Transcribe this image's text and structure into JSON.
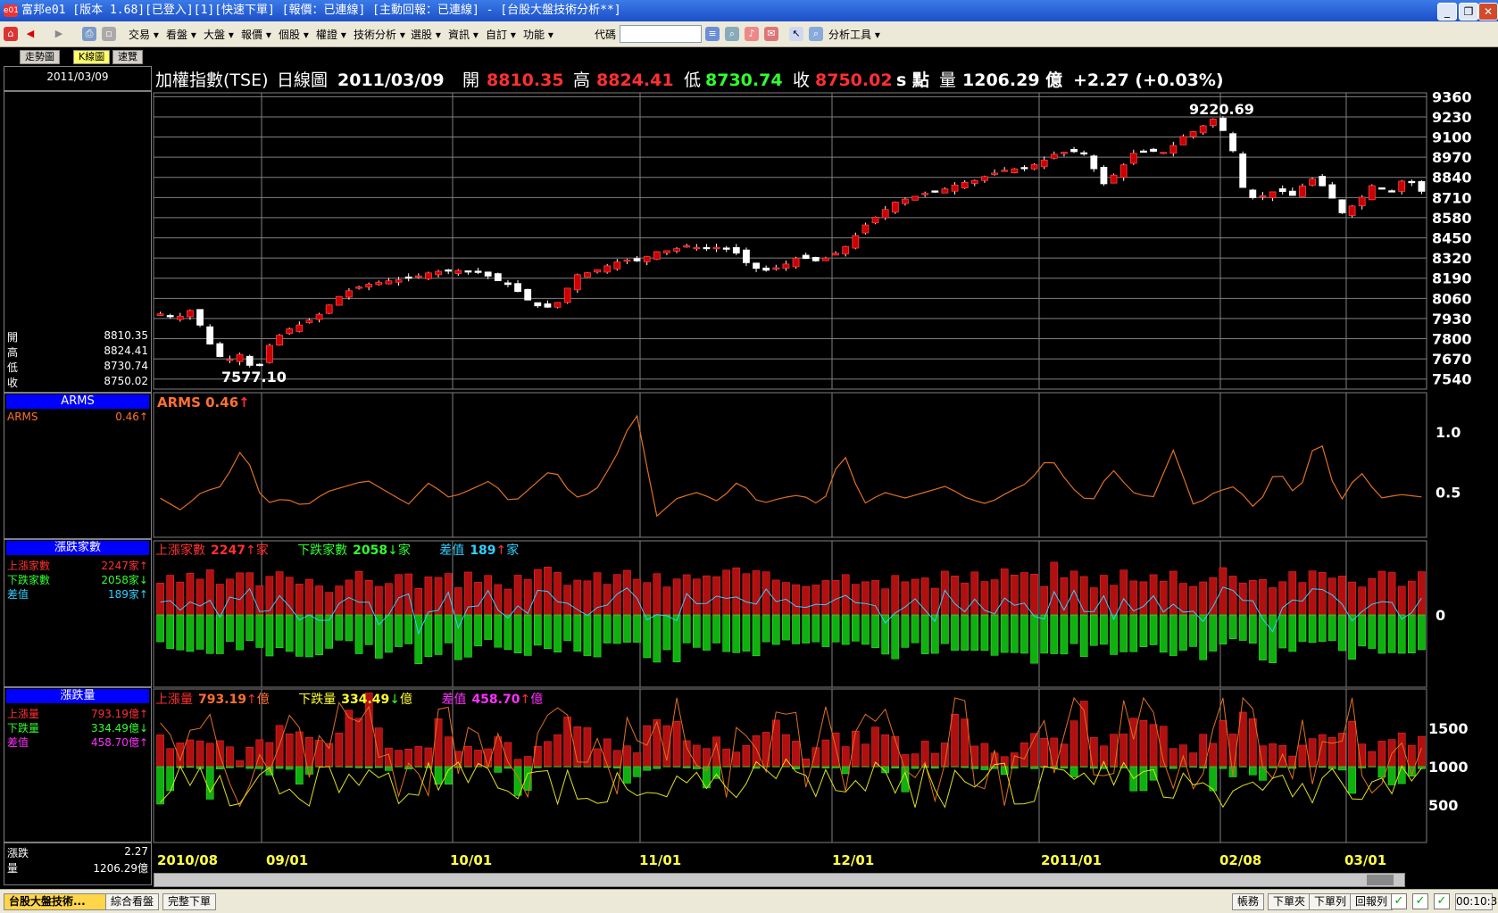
{
  "window": {
    "title": "富邦e01 [版本 1.68][已登入][1][快速下單] [報價：已連線] [主動回報：已連線] - [台股大盤技術分析**]",
    "app_icon": "e01"
  },
  "menu": {
    "items": [
      "交易",
      "看盤",
      "大盤",
      "報價",
      "個股",
      "權證",
      "技術分析",
      "選股",
      "資訊",
      "自訂",
      "功能"
    ],
    "code_label": "代碼",
    "analysis_tools": "分析工具"
  },
  "tabs": [
    "走勢圖",
    "K線圖",
    "速覽"
  ],
  "sidebar": {
    "date": "2011/03/09",
    "ohlc": [
      {
        "label": "開",
        "value": "8810.35"
      },
      {
        "label": "高",
        "value": "8824.41"
      },
      {
        "label": "低",
        "value": "8730.74"
      },
      {
        "label": "收",
        "value": "8750.02"
      }
    ],
    "arms_header": "ARMS",
    "arms": {
      "label": "ARMS",
      "value": "0.46↑"
    },
    "breadth_header": "漲跌家數",
    "breadth": [
      {
        "label": "上漲家數",
        "value": "2247家↑",
        "color": "#ff3030"
      },
      {
        "label": "下跌家數",
        "value": "2058家↓",
        "color": "#30ff30"
      },
      {
        "label": "差值",
        "value": "189家↑",
        "color": "#30d0ff"
      }
    ],
    "volume_header": "漲跌量",
    "volume": [
      {
        "label": "上漲量",
        "value": "793.19億↑",
        "color": "#ff3030"
      },
      {
        "label": "下跌量",
        "value": "334.49億↓",
        "color": "#30ff30"
      },
      {
        "label": "差值",
        "value": "458.70億↑",
        "color": "#ff30ff"
      }
    ],
    "bottom": [
      {
        "label": "漲跌",
        "value": "2.27"
      },
      {
        "label": "量",
        "value": "1206.29億"
      }
    ]
  },
  "header": {
    "title": "加權指數(TSE)",
    "chart_kind": "日線圖",
    "date": "2011/03/09",
    "open_label": "開",
    "open": "8810.35",
    "high_label": "高",
    "high": "8824.41",
    "low_label": "低",
    "low": "8730.74",
    "close_label": "收",
    "close": "8750.02",
    "unit": "s 點",
    "vol_label": "量",
    "vol": "1206.29 億",
    "change": "+2.27 (+0.03%)"
  },
  "arms_title": {
    "name": "ARMS",
    "value": "0.46"
  },
  "breadth_title": {
    "up_label": "上漲家數",
    "up": "2247",
    "down_label": "下跌家數",
    "down": "2058",
    "diff_label": "差值",
    "diff": "189",
    "unit": "家"
  },
  "volume_title": {
    "up_label": "上漲量",
    "up": "793.19",
    "down_label": "下跌量",
    "down": "334.49",
    "diff_label": "差值",
    "diff": "458.70",
    "unit": "億"
  },
  "colors": {
    "up_candle": "#cc0000",
    "down_candle": "#ffffff",
    "arms": "#e07020",
    "grid": "#808080",
    "price_label": "#ffffff",
    "up_text": "#ff3030",
    "down_text": "#30ff30"
  },
  "chart_data": {
    "type": "candlestick",
    "price_axis": {
      "ticks": [
        9360,
        9230,
        9100,
        8970,
        8840,
        8710,
        8580,
        8450,
        8320,
        8190,
        8060,
        7930,
        7800,
        7670,
        7540
      ],
      "ylim": [
        7475,
        9385
      ]
    },
    "x_ticks": [
      "2010/08",
      "09/01",
      "10/01",
      "11/01",
      "12/01",
      "2011/01",
      "02/08",
      "03/01"
    ],
    "annotations": [
      {
        "text": "9220.69",
        "kind": "high"
      },
      {
        "text": "7577.10",
        "kind": "low"
      }
    ],
    "arms_axis": {
      "ticks": [
        1.0,
        0.5
      ]
    },
    "breadth_axis": {
      "ticks": [
        0
      ]
    },
    "volume_axis": {
      "ticks": [
        1500,
        1000,
        500
      ]
    },
    "close_anchors": [
      7960,
      7930,
      7990,
      7780,
      7650,
      7700,
      7580,
      7790,
      7860,
      7900,
      7960,
      8060,
      8120,
      8150,
      8170,
      8180,
      8200,
      8230,
      8240,
      8240,
      8230,
      8180,
      8140,
      8050,
      7990,
      8040,
      8210,
      8230,
      8270,
      8310,
      8300,
      8360,
      8370,
      8400,
      8380,
      8390,
      8360,
      8260,
      8240,
      8270,
      8330,
      8300,
      8330,
      8400,
      8520,
      8600,
      8680,
      8710,
      8740,
      8760,
      8800,
      8820,
      8860,
      8890,
      8900,
      8930,
      8990,
      9010,
      8990,
      8790,
      8880,
      9000,
      9010,
      9000,
      9100,
      9150,
      9220,
      9080,
      8700,
      8720,
      8760,
      8720,
      8840,
      8770,
      8610,
      8680,
      8800,
      8740,
      8840,
      8750
    ],
    "arms_anchors": [
      0.45,
      0.35,
      0.5,
      0.55,
      0.88,
      0.4,
      0.45,
      0.38,
      0.5,
      0.55,
      0.6,
      0.5,
      0.4,
      0.58,
      0.45,
      0.52,
      0.6,
      0.4,
      0.55,
      0.7,
      0.45,
      0.5,
      0.78,
      1.18,
      0.3,
      0.45,
      0.5,
      0.42,
      0.6,
      0.4,
      0.45,
      0.48,
      0.38,
      0.85,
      0.4,
      0.5,
      0.45,
      0.5,
      0.55,
      0.45,
      0.4,
      0.5,
      0.58,
      0.8,
      0.55,
      0.4,
      0.7,
      0.5,
      0.45,
      0.85,
      0.38,
      0.5,
      0.55,
      0.35,
      0.7,
      0.45,
      1.0,
      0.4,
      0.68,
      0.45,
      0.48,
      0.46
    ],
    "breadth_up_anchors": [
      600,
      520,
      680,
      540,
      630,
      550,
      720,
      610,
      500,
      640,
      560,
      690,
      580,
      620,
      540,
      700,
      600,
      540,
      720,
      660,
      580,
      640,
      700,
      620,
      520,
      700,
      660,
      720,
      600,
      640,
      560,
      700,
      650,
      750,
      580,
      630,
      520,
      640,
      700,
      600,
      760,
      560,
      800,
      640,
      600,
      700,
      540,
      760,
      650,
      600,
      800,
      660,
      560,
      720,
      620,
      700,
      580,
      680,
      640,
      720
    ],
    "breadth_down_anchors": [
      540,
      700,
      580,
      640,
      500,
      680,
      560,
      720,
      600,
      520,
      640,
      580,
      700,
      560,
      640,
      520,
      600,
      680,
      560,
      500,
      640,
      600,
      520,
      660,
      700,
      520,
      560,
      600,
      640,
      520,
      620,
      560,
      640,
      500,
      680,
      560,
      720,
      600,
      520,
      640,
      560,
      700,
      520,
      600,
      660,
      560,
      720,
      560,
      600,
      680,
      520,
      560,
      700,
      540,
      640,
      560,
      680,
      600,
      620,
      500
    ],
    "vol_up_anchors": [
      1350,
      1200,
      1450,
      1100,
      1300,
      1550,
      1250,
      1400,
      1700,
      1150,
      1300,
      1500,
      1200,
      1350,
      1100,
      1250,
      1600,
      1300,
      1150,
      1400,
      1700,
      1200,
      1350,
      1250,
      1500,
      1100,
      1300,
      1400,
      1600,
      1200,
      1250,
      1500,
      1350,
      1100,
      1400,
      1200,
      1700,
      1300,
      1500,
      1350,
      1250,
      1400,
      1600,
      1300,
      1150,
      1450,
      1500,
      1250,
      1350,
      1400
    ],
    "vol_down_anchors": [
      700,
      50,
      650,
      30,
      40,
      520,
      40,
      30,
      300,
      40,
      50,
      400,
      30,
      40,
      600,
      30,
      60,
      40,
      350,
      40,
      30,
      500,
      40,
      30,
      50,
      40,
      300,
      30,
      40,
      500,
      30,
      40,
      600,
      30,
      40,
      350,
      30,
      40,
      550,
      40,
      30,
      500,
      40,
      300,
      30,
      40,
      700,
      30,
      400,
      40
    ]
  }
}
